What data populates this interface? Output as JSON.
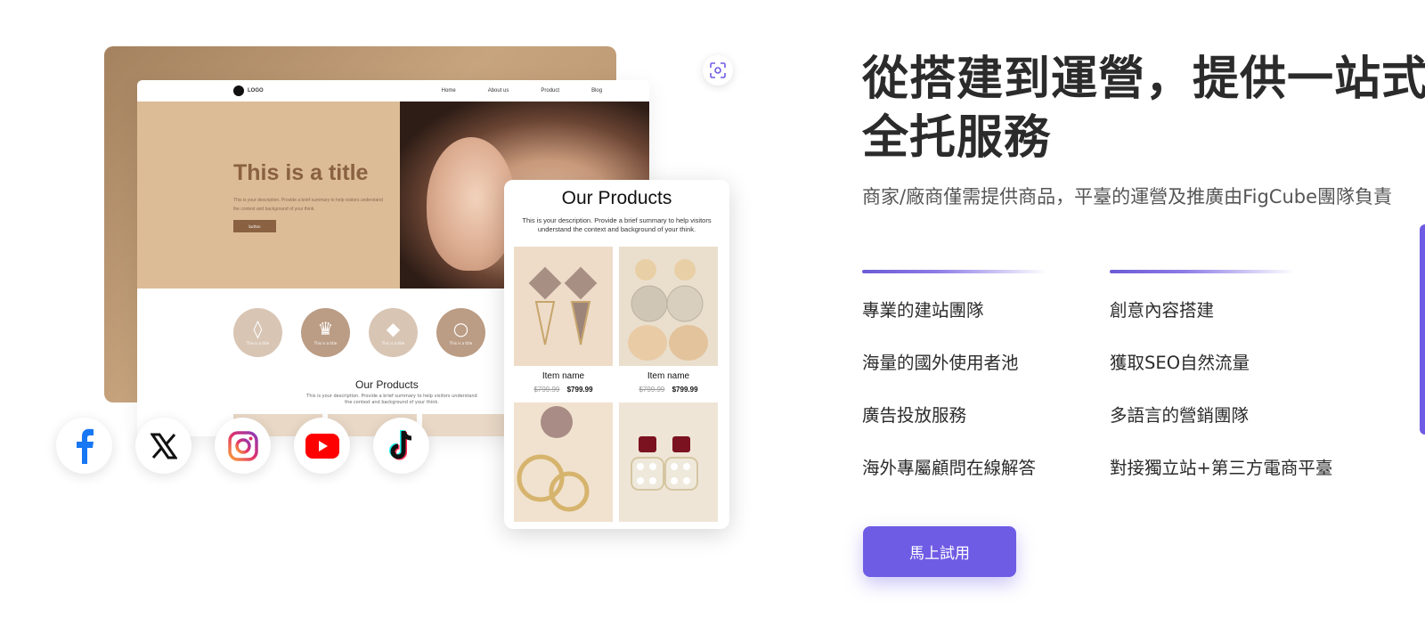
{
  "mockup": {
    "site": {
      "logo": "LOGO",
      "nav": [
        "Home",
        "About us",
        "Product",
        "Blog"
      ],
      "hero_title": "This is a title",
      "hero_desc": "This is your description. Provide a brief summary to help visitors understand the context and background of your think.",
      "hero_button": "button",
      "circle_captions": [
        "This is a title",
        "This is a title",
        "This is a title",
        "This is a title"
      ],
      "products_title": "Our Products",
      "products_desc": "This is your description. Provide a brief summary to help visitors understand the context and background of your think."
    },
    "product_card": {
      "title": "Our Products",
      "desc": "This is your description. Provide a brief summary to help visitors understand the context and background of your think.",
      "items": [
        {
          "name": "Item name",
          "old_price": "$799.99",
          "price": "$799.99"
        },
        {
          "name": "Item name",
          "old_price": "$799.99",
          "price": "$799.99"
        }
      ]
    },
    "socials": [
      "facebook-icon",
      "x-icon",
      "instagram-icon",
      "youtube-icon",
      "tiktok-icon"
    ]
  },
  "content": {
    "headline": "從搭建到運營，提供一站式全托服務",
    "subline": "商家/廠商僅需提供商品，平臺的運營及推廣由FigCube團隊負責",
    "features_left": [
      "專業的建站團隊",
      "海量的國外使用者池",
      "廣告投放服務",
      "海外專屬顧問在線解答"
    ],
    "features_right": [
      "創意內容搭建",
      "獲取SEO自然流量",
      "多語言的營銷團隊",
      "對接獨立站+第三方電商平臺"
    ],
    "cta": "馬上試用"
  },
  "colors": {
    "accent": "#6e5ce5",
    "brown": "#8a6141"
  }
}
